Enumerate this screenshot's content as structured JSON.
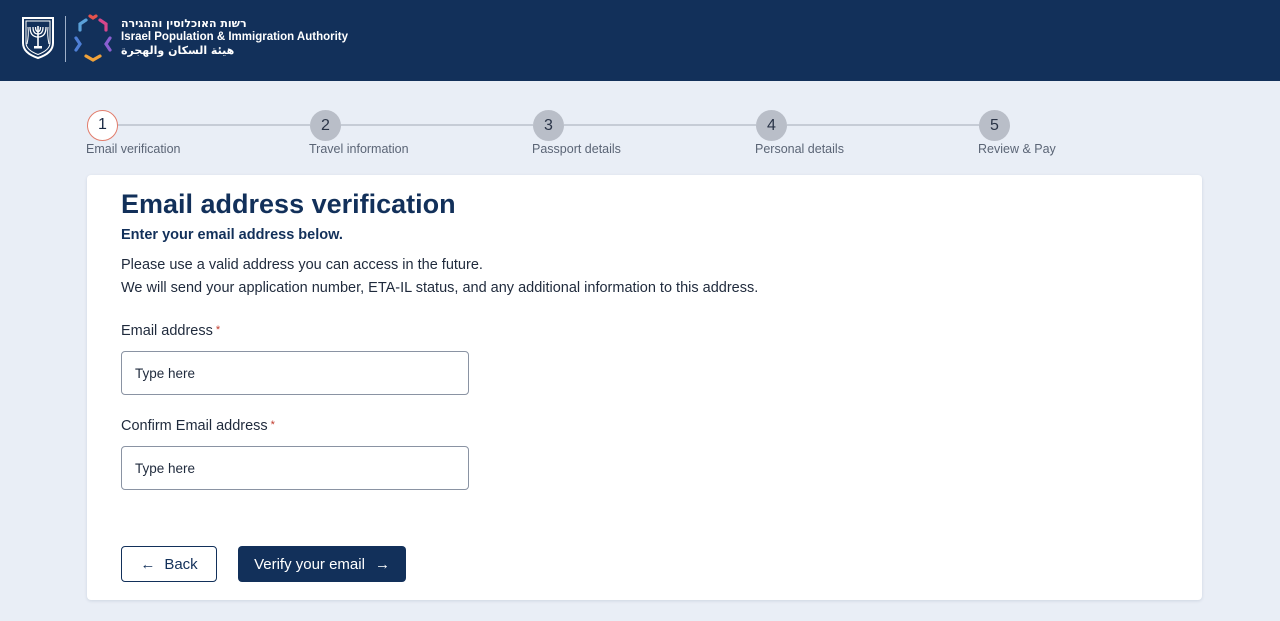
{
  "header": {
    "title_hebrew": "רשות האוכלוסין וההגירה",
    "title_english": "Israel Population & Immigration Authority",
    "title_arabic": "هيئة السكان والهجرة",
    "emblem_icon": "state-emblem-icon",
    "logo_icon": "authority-star-logo-icon",
    "background_color": "#12305a"
  },
  "stepper": {
    "steps": [
      {
        "number": "1",
        "label": "Email verification",
        "active": true
      },
      {
        "number": "2",
        "label": "Travel information",
        "active": false
      },
      {
        "number": "3",
        "label": "Passport details",
        "active": false
      },
      {
        "number": "4",
        "label": "Personal details",
        "active": false
      },
      {
        "number": "5",
        "label": "Review & Pay",
        "active": false
      }
    ]
  },
  "form": {
    "title": "Email address verification",
    "subtitle": "Enter your email address below.",
    "description_line1": "Please use a valid address you can access in the future.",
    "description_line2": "We will send your application number, ETA-IL status, and any additional information to this address.",
    "email": {
      "label": "Email address",
      "required_mark": "*",
      "placeholder": "Type here",
      "value": ""
    },
    "confirm_email": {
      "label": "Confirm Email address",
      "required_mark": "*",
      "placeholder": "Type here",
      "value": ""
    },
    "back_label": "Back",
    "back_icon": "arrow-left-icon",
    "verify_label": "Verify your email",
    "verify_icon": "arrow-right-icon"
  },
  "colors": {
    "primary": "#12305a",
    "active_step_border": "#e27d6c",
    "required": "#c0392b",
    "page_background": "#e9eef6"
  }
}
